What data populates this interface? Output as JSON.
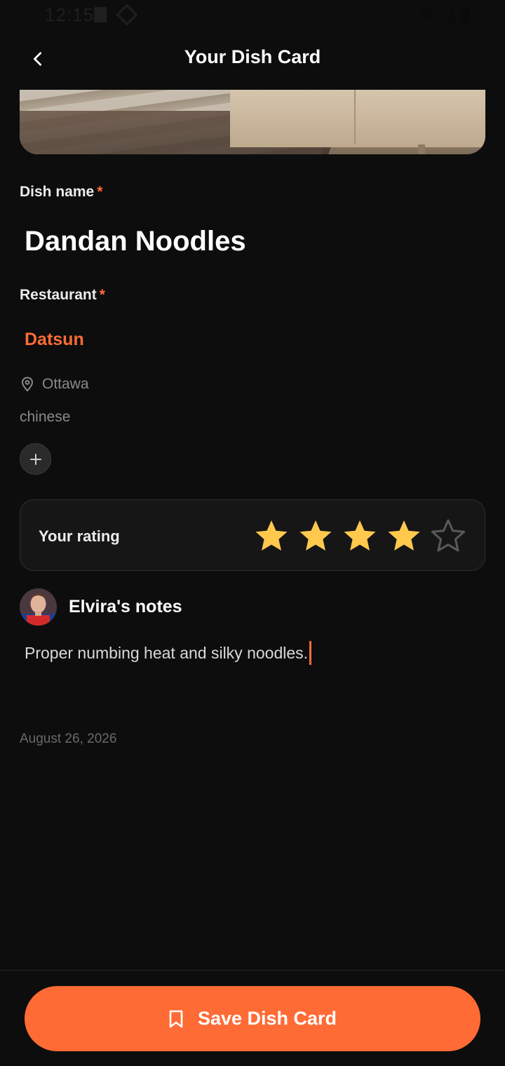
{
  "status_bar": {
    "time": "12:15"
  },
  "header": {
    "title": "Your Dish Card",
    "back_icon": "chevron-left-icon"
  },
  "hero": {
    "image": "dish-photo"
  },
  "dish": {
    "label": "Dish name",
    "required_mark": "*",
    "value": "Dandan Noodles"
  },
  "restaurant": {
    "label": "Restaurant",
    "required_mark": "*",
    "value": "Datsun",
    "location": "Ottawa",
    "location_icon": "map-pin-icon",
    "cuisine": "chinese",
    "add_icon": "plus-icon"
  },
  "rating": {
    "label": "Your rating",
    "value": 4,
    "max": 5,
    "filled_color": "#FFC94D",
    "empty_color": "#5a5a5a"
  },
  "notes": {
    "author_title": "Elvira's notes",
    "text": "Proper numbing heat and silky noodles.",
    "date": "August 26, 2026"
  },
  "footer": {
    "save_label": "Save Dish Card",
    "save_icon": "bookmark-icon"
  },
  "colors": {
    "accent": "#FF6B35",
    "background": "#0D0D0D",
    "card": "#161616"
  }
}
